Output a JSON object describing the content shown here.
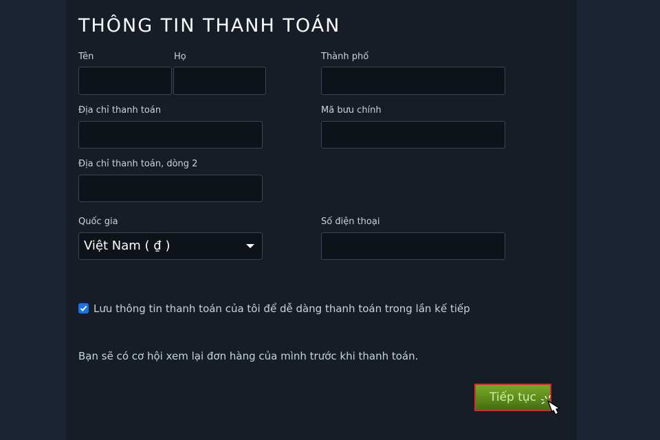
{
  "form": {
    "title": "THÔNG TIN THANH TOÁN",
    "first_name_label": "Tên",
    "last_name_label": "Họ",
    "city_label": "Thành phố",
    "address_label": "Địa chỉ thanh toán",
    "postal_label": "Mã bưu chính",
    "address2_label": "Địa chỉ thanh toán, dòng 2",
    "country_label": "Quốc gia",
    "country_value": "Việt Nam ( ₫ )",
    "phone_label": "Số điện thoại",
    "first_name_value": "",
    "last_name_value": "",
    "city_value": "",
    "address_value": "",
    "postal_value": "",
    "address2_value": "",
    "phone_value": "",
    "save_info_label": "Lưu thông tin thanh toán của tôi để dễ dàng thanh toán trong lần kế tiếp",
    "save_info_checked": true,
    "review_note": "Bạn sẽ có cơ hội xem lại đơn hàng của mình trước khi thanh toán.",
    "continue_label": "Tiếp tục"
  },
  "colors": {
    "background": "#1b2533",
    "panel": "#161d27",
    "input_bg": "#0e131a",
    "checkbox": "#1a73e8",
    "button_green": "#5d8a1b",
    "highlight_border": "#e02828"
  }
}
